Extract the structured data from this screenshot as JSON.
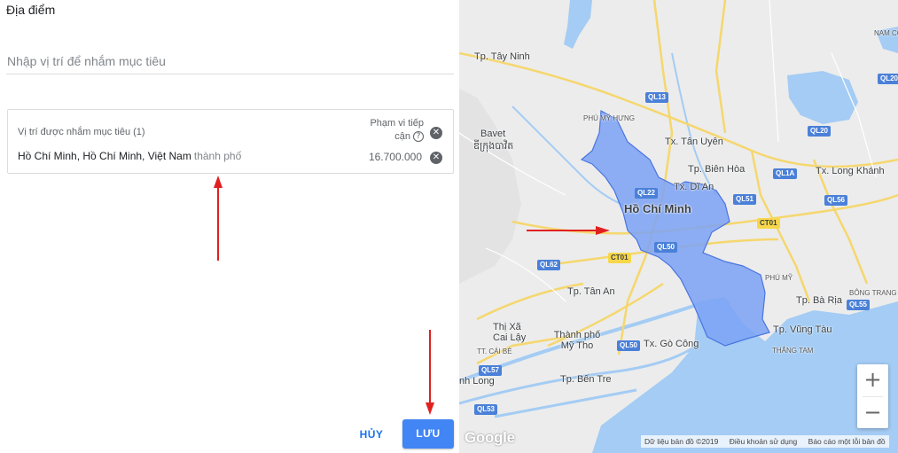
{
  "panel": {
    "title": "Địa điểm",
    "search_placeholder": "Nhập vị trí để nhắm mục tiêu"
  },
  "targets": {
    "header_label": "Vị trí được nhắm mục tiêu (1)",
    "reach_label": "Phạm vi tiếp cận",
    "help_icon_glyph": "?",
    "rows": [
      {
        "name": "Hồ Chí Minh, Hồ Chí Minh, Việt Nam",
        "type": "thành phố",
        "reach": "16.700.000"
      }
    ]
  },
  "buttons": {
    "cancel": "HỦY",
    "save": "LƯU"
  },
  "map": {
    "labels": {
      "tay_ninh": "Tp. Tây Ninh",
      "phu_my_hung": "PHÚ MỸ HƯNG",
      "tan_uyen": "Tx. Tân Uyên",
      "bien_hoa": "Tp. Biên Hòa",
      "di_an": "Tx. Dĩ An",
      "long_khanh": "Tx. Long Khánh",
      "ho_chi_minh": "Hồ Chí Minh",
      "bavet": "Bavet",
      "bavet_kh": "ឌីក្រុងបាវិត",
      "tan_an": "Tp. Tân An",
      "phu_my": "PHÚ MỸ",
      "ba_ria": "Tp. Bà Rịa",
      "bong_trang": "BÔNG TRANG",
      "thi_xa_cai_lay": "Thị Xã Cai Lậy",
      "thanh_pho_my_tho": "Thành phố Mỹ Tho",
      "go_cong": "Tx. Gò Công",
      "vung_tau": "Tp. Vũng Tàu",
      "thang_tam": "THẮNG TAM",
      "tt_cai_be": "TT. CÁI BÈ",
      "vinh_long": "nh Long",
      "ben_tre": "Tp. Bến Tre",
      "nam_co": "NAM CO"
    },
    "shields": {
      "ql13": "QL13",
      "ql22": "QL22",
      "ql51": "QL51",
      "ql1a": "QL1A",
      "ql20": "QL20",
      "ql20b": "QL20",
      "ql56": "QL56",
      "ct01a": "CT01",
      "ct01b": "CT01",
      "ql50a": "QL50",
      "ql62": "QL62",
      "ql50b": "QL50",
      "ql55": "QL55",
      "ql57": "QL57",
      "ql53": "QL53"
    },
    "zoom_in": "+",
    "zoom_out": "−",
    "logo": "Google",
    "attribution": {
      "data": "Dữ liệu bản đồ ©2019",
      "terms": "Điều khoản sử dụng",
      "report": "Báo cáo một lỗi bản đồ"
    },
    "colors": {
      "water": "#a4ccf4",
      "region_fill": "#7ba2f5",
      "region_stroke": "#4a74e0",
      "arrow": "#e02020"
    }
  }
}
